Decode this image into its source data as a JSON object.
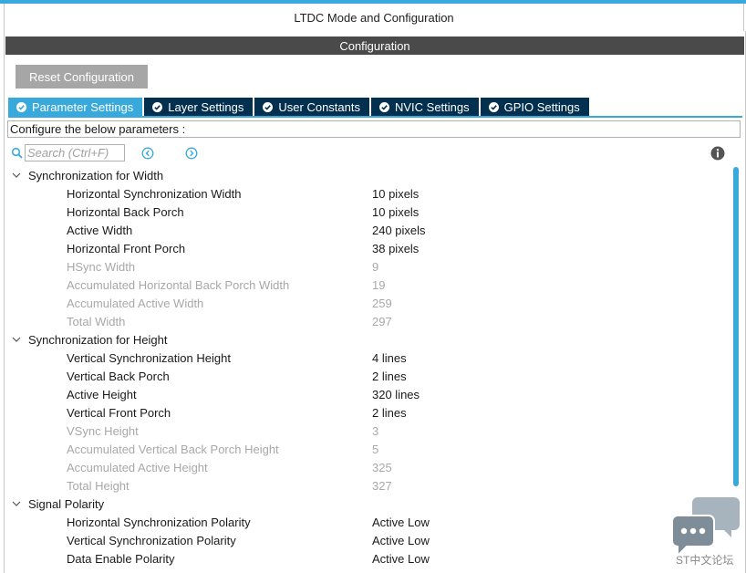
{
  "window": {
    "title": "LTDC Mode and Configuration"
  },
  "config": {
    "header": "Configuration",
    "reset_label": "Reset Configuration",
    "tabs": [
      {
        "label": "Parameter Settings",
        "active": true
      },
      {
        "label": "Layer Settings",
        "active": false
      },
      {
        "label": "User Constants",
        "active": false
      },
      {
        "label": "NVIC Settings",
        "active": false
      },
      {
        "label": "GPIO Settings",
        "active": false
      }
    ],
    "description": "Configure the below parameters :",
    "search_placeholder": "Search (Ctrl+F)"
  },
  "groups": [
    {
      "title": "Synchronization for Width",
      "params": [
        {
          "name": "Horizontal Synchronization Width",
          "value": "10 pixels",
          "editable": true
        },
        {
          "name": "Horizontal Back Porch",
          "value": "10 pixels",
          "editable": true
        },
        {
          "name": "Active Width",
          "value": "240 pixels",
          "editable": true
        },
        {
          "name": "Horizontal Front Porch",
          "value": "38 pixels",
          "editable": true
        },
        {
          "name": "HSync Width",
          "value": "9",
          "editable": false
        },
        {
          "name": "Accumulated Horizontal Back Porch Width",
          "value": "19",
          "editable": false
        },
        {
          "name": "Accumulated Active Width",
          "value": "259",
          "editable": false
        },
        {
          "name": "Total Width",
          "value": "297",
          "editable": false
        }
      ]
    },
    {
      "title": "Synchronization for Height",
      "params": [
        {
          "name": "Vertical Synchronization Height",
          "value": "4 lines",
          "editable": true
        },
        {
          "name": "Vertical Back Porch",
          "value": "2 lines",
          "editable": true
        },
        {
          "name": "Active Height",
          "value": "320 lines",
          "editable": true
        },
        {
          "name": "Vertical Front Porch",
          "value": "2 lines",
          "editable": true
        },
        {
          "name": "VSync Height",
          "value": "3",
          "editable": false
        },
        {
          "name": "Accumulated Vertical Back Porch Height",
          "value": "5",
          "editable": false
        },
        {
          "name": "Accumulated Active Height",
          "value": "325",
          "editable": false
        },
        {
          "name": "Total Height",
          "value": "327",
          "editable": false
        }
      ]
    },
    {
      "title": "Signal Polarity",
      "params": [
        {
          "name": "Horizontal Synchronization Polarity",
          "value": "Active Low",
          "editable": true
        },
        {
          "name": "Vertical Synchronization Polarity",
          "value": "Active Low",
          "editable": true
        },
        {
          "name": "Data Enable Polarity",
          "value": "Active Low",
          "editable": true
        }
      ]
    }
  ],
  "watermark": {
    "text": "ST中文论坛"
  },
  "colors": {
    "accent": "#39a9db",
    "tab_dark": "#04304f",
    "header": "#4a4a4a",
    "disabled": "#a8a8a8"
  }
}
